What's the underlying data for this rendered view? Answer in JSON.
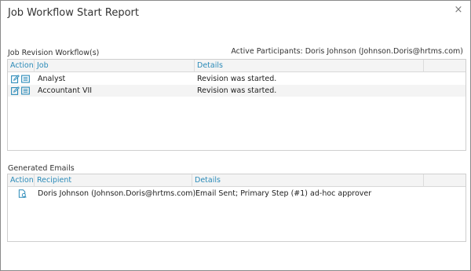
{
  "dialog": {
    "title": "Job Workflow Start Report",
    "close_label": "×"
  },
  "workflow": {
    "section_title": "Job Revision Workflow(s)",
    "participants": "Active Participants: Doris Johnson (Johnson.Doris@hrtms.com)",
    "columns": [
      "Action",
      "Job",
      "Details"
    ],
    "rows": [
      {
        "job": "Analyst",
        "details": "Revision was started.",
        "action_icons": [
          "edit-icon",
          "details-icon"
        ]
      },
      {
        "job": "Accountant VII",
        "details": "Revision was started.",
        "action_icons": [
          "edit-icon",
          "details-icon"
        ]
      }
    ]
  },
  "emails": {
    "section_title": "Generated Emails",
    "columns": [
      "Action",
      "Recipient",
      "Details"
    ],
    "rows": [
      {
        "recipient": "Doris Johnson (Johnson.Doris@hrtms.com)",
        "details": "Email Sent; Primary Step (#1) ad-hoc approver",
        "action_icon": "email-view-icon"
      }
    ]
  },
  "colors": {
    "header_text": "#2a8ab8",
    "icon": "#2a8ab8"
  }
}
